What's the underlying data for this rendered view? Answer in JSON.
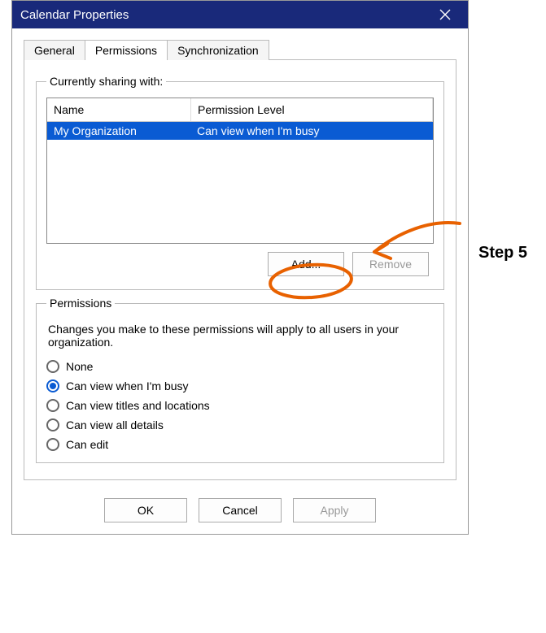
{
  "dialog": {
    "title": "Calendar Properties"
  },
  "tabs": {
    "general": "General",
    "permissions": "Permissions",
    "synchronization": "Synchronization"
  },
  "sharing": {
    "legend": "Currently sharing with:",
    "columns": {
      "name": "Name",
      "permission": "Permission Level"
    },
    "rows": [
      {
        "name": "My Organization",
        "permission": "Can view when I'm busy"
      }
    ],
    "add_label": "Add...",
    "remove_label": "Remove"
  },
  "permissions": {
    "legend": "Permissions",
    "note": "Changes you make to these permissions will apply to all users in your organization.",
    "options": {
      "none": "None",
      "busy": "Can view when I'm busy",
      "titles": "Can view titles and locations",
      "details": "Can view all details",
      "edit": "Can edit"
    },
    "selected": "busy"
  },
  "footer": {
    "ok": "OK",
    "cancel": "Cancel",
    "apply": "Apply"
  },
  "annotation": {
    "step_label": "Step 5",
    "color": "#e86100"
  }
}
